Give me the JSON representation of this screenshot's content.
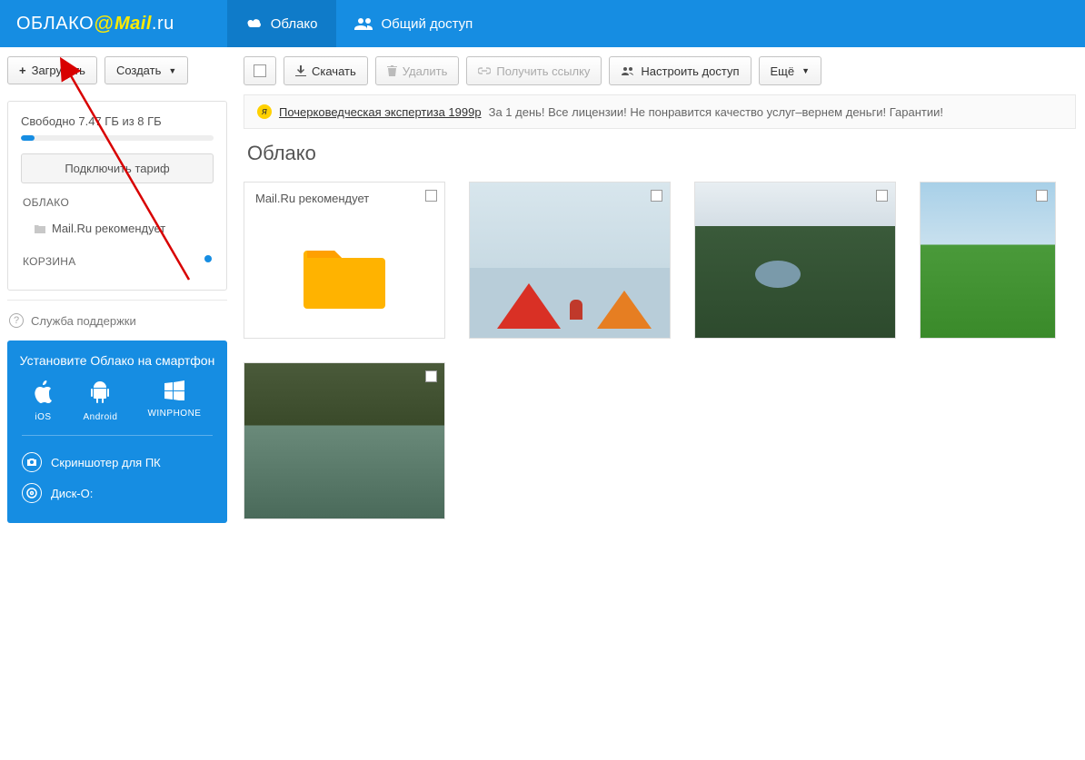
{
  "header": {
    "logo_part1": "ОБЛАКО",
    "logo_at": "@",
    "logo_part2": "Mail",
    "logo_part3": ".ru",
    "tabs": [
      {
        "label": "Облако",
        "active": true
      },
      {
        "label": "Общий доступ",
        "active": false
      }
    ]
  },
  "sidebar": {
    "upload_btn": "Загрузить",
    "create_btn": "Создать",
    "storage_text": "Свободно 7.47 ГБ из 8 ГБ",
    "storage_percent_used": 7,
    "tariff_btn": "Подключить тариф",
    "cloud_label": "ОБЛАКО",
    "cloud_item": "Mail.Ru рекомендует",
    "trash_label": "КОРЗИНА",
    "support_label": "Служба поддержки",
    "promo": {
      "title": "Установите Облако на смартфон",
      "apps": [
        {
          "label": "iOS"
        },
        {
          "label": "Android"
        },
        {
          "label": "WINPHONE"
        }
      ],
      "links": [
        {
          "label": "Скриншотер для ПК"
        },
        {
          "label": "Диск-О:"
        }
      ]
    }
  },
  "toolbar": {
    "download": "Скачать",
    "delete": "Удалить",
    "get_link": "Получить ссылку",
    "share": "Настроить доступ",
    "more": "Ещё"
  },
  "ad": {
    "link_text": "Почерковедческая экспертиза 1999р",
    "rest": "За 1 день! Все лицензии! Не понравится качество услуг–вернем деньги! Гарантии!"
  },
  "page_title": "Облако",
  "tiles": {
    "folder_label": "Mail.Ru рекомендует"
  }
}
